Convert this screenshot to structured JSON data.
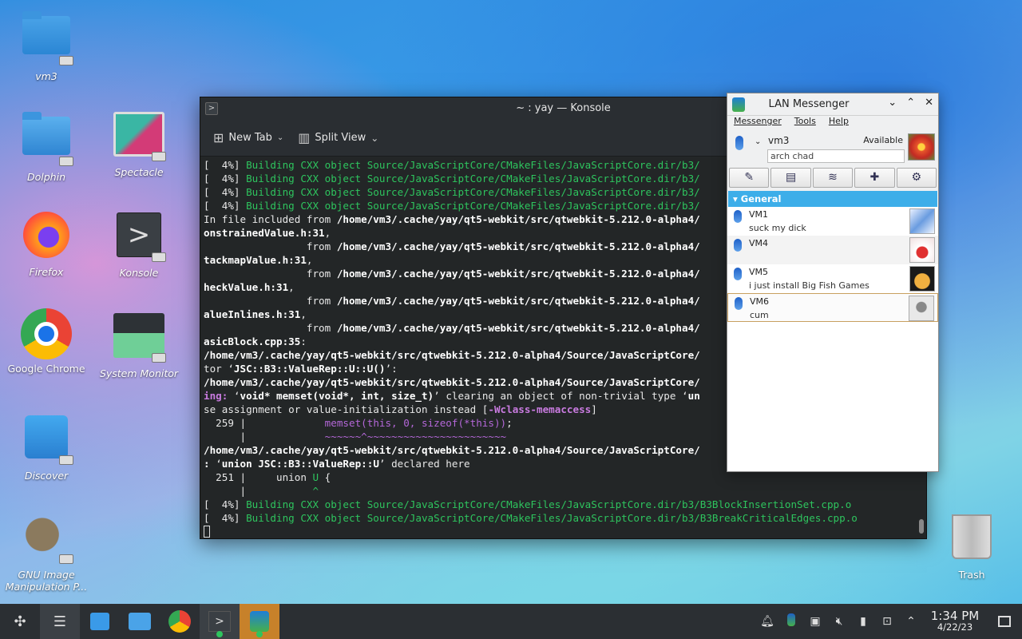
{
  "desktop": {
    "icons": [
      {
        "label": "vm3"
      },
      {
        "label": "Dolphin"
      },
      {
        "label": "Spectacle"
      },
      {
        "label": "Firefox"
      },
      {
        "label": "Konsole"
      },
      {
        "label": "Google Chrome"
      },
      {
        "label": "System Monitor"
      },
      {
        "label": "Discover"
      },
      {
        "label": "GNU Image Manipulation P..."
      },
      {
        "label": "Trash"
      }
    ]
  },
  "konsole": {
    "title": "~ : yay — Konsole",
    "new_tab": "New Tab",
    "split_view": "Split View",
    "lines": [
      [
        {
          "c": "n",
          "t": "[  4%] "
        },
        {
          "c": "g",
          "t": "Building CXX object Source/JavaScriptCore/CMakeFiles/JavaScriptCore.dir/b3/"
        }
      ],
      [
        {
          "c": "n",
          "t": "[  4%] "
        },
        {
          "c": "g",
          "t": "Building CXX object Source/JavaScriptCore/CMakeFiles/JavaScriptCore.dir/b3/"
        }
      ],
      [
        {
          "c": "n",
          "t": "[  4%] "
        },
        {
          "c": "g",
          "t": "Building CXX object Source/JavaScriptCore/CMakeFiles/JavaScriptCore.dir/b3/"
        }
      ],
      [
        {
          "c": "n",
          "t": "[  4%] "
        },
        {
          "c": "g",
          "t": "Building CXX object Source/JavaScriptCore/CMakeFiles/JavaScriptCore.dir/b3/"
        }
      ],
      [
        {
          "c": "n",
          "t": "In file included from "
        },
        {
          "c": "b",
          "t": "/home/vm3/.cache/yay/qt5-webkit/src/qtwebkit-5.212.0-alpha4/"
        }
      ],
      [
        {
          "c": "b",
          "t": "onstrainedValue.h:31"
        },
        {
          "c": "n",
          "t": ","
        }
      ],
      [
        {
          "c": "n",
          "t": "                 from "
        },
        {
          "c": "b",
          "t": "/home/vm3/.cache/yay/qt5-webkit/src/qtwebkit-5.212.0-alpha4/"
        }
      ],
      [
        {
          "c": "b",
          "t": "tackmapValue.h:31"
        },
        {
          "c": "n",
          "t": ","
        }
      ],
      [
        {
          "c": "n",
          "t": "                 from "
        },
        {
          "c": "b",
          "t": "/home/vm3/.cache/yay/qt5-webkit/src/qtwebkit-5.212.0-alpha4/"
        }
      ],
      [
        {
          "c": "b",
          "t": "heckValue.h:31"
        },
        {
          "c": "n",
          "t": ","
        }
      ],
      [
        {
          "c": "n",
          "t": "                 from "
        },
        {
          "c": "b",
          "t": "/home/vm3/.cache/yay/qt5-webkit/src/qtwebkit-5.212.0-alpha4/"
        }
      ],
      [
        {
          "c": "b",
          "t": "alueInlines.h:31"
        },
        {
          "c": "n",
          "t": ","
        }
      ],
      [
        {
          "c": "n",
          "t": "                 from "
        },
        {
          "c": "b",
          "t": "/home/vm3/.cache/yay/qt5-webkit/src/qtwebkit-5.212.0-alpha4/"
        }
      ],
      [
        {
          "c": "b",
          "t": "asicBlock.cpp:35"
        },
        {
          "c": "n",
          "t": ":"
        }
      ],
      [
        {
          "c": "b",
          "t": "/home/vm3/.cache/yay/qt5-webkit/src/qtwebkit-5.212.0-alpha4/Source/JavaScriptCore/"
        }
      ],
      [
        {
          "c": "n",
          "t": "tor ‘"
        },
        {
          "c": "b",
          "t": "JSC::B3::ValueRep::U::U()"
        },
        {
          "c": "n",
          "t": "’:"
        }
      ],
      [
        {
          "c": "b",
          "t": "/home/vm3/.cache/yay/qt5-webkit/src/qtwebkit-5.212.0-alpha4/Source/JavaScriptCore/"
        }
      ],
      [
        {
          "c": "mb",
          "t": "ing: "
        },
        {
          "c": "n",
          "t": "‘"
        },
        {
          "c": "b",
          "t": "void* memset(void*, int, size_t)"
        },
        {
          "c": "n",
          "t": "’ clearing an object of non-trivial type ‘"
        },
        {
          "c": "b",
          "t": "un"
        }
      ],
      [
        {
          "c": "n",
          "t": "se assignment or value-initialization instead ["
        },
        {
          "c": "mb",
          "t": "-Wclass-memaccess"
        },
        {
          "c": "n",
          "t": "]"
        }
      ],
      [
        {
          "c": "n",
          "t": "  259 |             "
        },
        {
          "c": "m",
          "t": "memset(this, 0, sizeof(*this))"
        },
        {
          "c": "n",
          "t": ";"
        }
      ],
      [
        {
          "c": "n",
          "t": "      |             "
        },
        {
          "c": "m",
          "t": "~~~~~~^~~~~~~~~~~~~~~~~~~~~~~~"
        }
      ],
      [
        {
          "c": "b",
          "t": "/home/vm3/.cache/yay/qt5-webkit/src/qtwebkit-5.212.0-alpha4/Source/JavaScriptCore/"
        }
      ],
      [
        {
          "c": "b",
          "t": ": "
        },
        {
          "c": "n",
          "t": "‘"
        },
        {
          "c": "b",
          "t": "union JSC::B3::ValueRep::U"
        },
        {
          "c": "n",
          "t": "’ declared here"
        }
      ],
      [
        {
          "c": "n",
          "t": "  251 |     union "
        },
        {
          "c": "gr",
          "t": "U"
        },
        {
          "c": "n",
          "t": " {"
        }
      ],
      [
        {
          "c": "n",
          "t": "      |           "
        },
        {
          "c": "gr",
          "t": "^"
        }
      ],
      [
        {
          "c": "n",
          "t": "[  4%] "
        },
        {
          "c": "g",
          "t": "Building CXX object Source/JavaScriptCore/CMakeFiles/JavaScriptCore.dir/b3/B3BlockInsertionSet.cpp.o"
        }
      ],
      [
        {
          "c": "n",
          "t": "[  4%] "
        },
        {
          "c": "g",
          "t": "Building CXX object Source/JavaScriptCore/CMakeFiles/JavaScriptCore.dir/b3/B3BreakCriticalEdges.cpp.o"
        }
      ]
    ]
  },
  "lanm": {
    "title": "LAN Messenger",
    "menu": {
      "messenger": "Messenger",
      "tools": "Tools",
      "help": "Help"
    },
    "username": "vm3",
    "status": "Available",
    "note": "arch chad",
    "group": "General",
    "users": [
      {
        "name": "VM1",
        "msg": "suck my dick"
      },
      {
        "name": "VM4",
        "msg": ""
      },
      {
        "name": "VM5",
        "msg": "i just install Big Fish Games"
      },
      {
        "name": "VM6",
        "msg": "cum"
      }
    ]
  },
  "taskbar": {
    "time": "1:34 PM",
    "date": "4/22/23"
  },
  "colors": {
    "konsole_bg": "#232627",
    "build_green": "#2ec45e",
    "warning_magenta": "#b467d8",
    "group_blue": "#3daee9",
    "taskbar_bg": "#2b2f33",
    "active_task_orange": "#c7812a"
  }
}
